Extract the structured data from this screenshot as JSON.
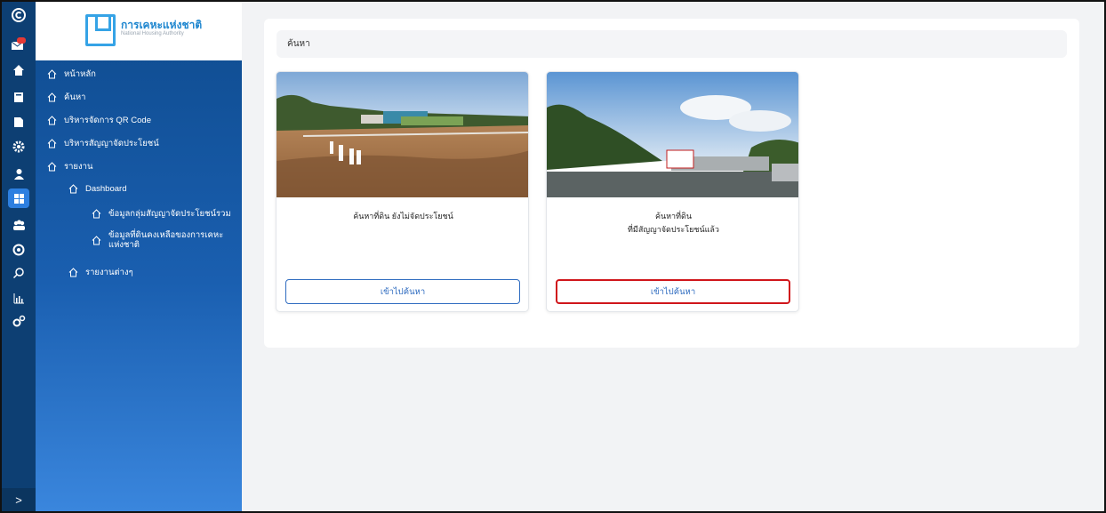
{
  "app": {
    "logo_th": "การเคหะแห่งชาติ",
    "logo_en": "National Housing Authority",
    "brand_color": "#0e4b8e",
    "accent_color": "#2f6cc0",
    "highlight_color": "#d0161b"
  },
  "rail": {
    "items": [
      {
        "icon": "copyright-logo-icon"
      },
      {
        "icon": "mail-notification-icon",
        "badge": "99+"
      },
      {
        "icon": "home-icon"
      },
      {
        "icon": "book-icon"
      },
      {
        "icon": "document-icon"
      },
      {
        "icon": "gear-icon"
      },
      {
        "icon": "user-icon"
      },
      {
        "icon": "dashboard-icon"
      },
      {
        "icon": "users-group-icon"
      },
      {
        "icon": "settings-cog-icon"
      },
      {
        "icon": "search-icon"
      },
      {
        "icon": "bar-chart-icon"
      },
      {
        "icon": "cogs-icon"
      }
    ],
    "expand_label": ">"
  },
  "sidebar": {
    "items": [
      {
        "label": "หน้าหลัก",
        "icon": "home-outline-icon"
      },
      {
        "label": "ค้นหา",
        "icon": "home-outline-icon"
      },
      {
        "label": "บริหารจัดการ QR Code",
        "icon": "home-outline-icon"
      },
      {
        "label": "บริหารสัญญาจัดประโยชน์",
        "icon": "home-outline-icon"
      },
      {
        "label": "รายงาน",
        "icon": "home-outline-icon"
      },
      {
        "label": "Dashboard",
        "icon": "home-outline-icon"
      },
      {
        "label": "ข้อมูลกลุ่มสัญญาจัดประโยชน์รวม",
        "icon": "home-outline-icon"
      },
      {
        "label": "ข้อมูลที่ดินคงเหลือของการเคหะแห่งชาติ",
        "icon": "home-outline-icon"
      },
      {
        "label": "รายงานต่างๆ",
        "icon": "home-outline-icon"
      }
    ]
  },
  "main": {
    "search_label": "ค้นหา",
    "cards": [
      {
        "title_line1": "ค้นหาที่ดิน ยังไม่จัดประโยชน์",
        "title_line2": "",
        "button_label": "เข้าไปค้นหา",
        "image_alt": "empty-land-photo"
      },
      {
        "title_line1": "ค้นหาที่ดิน",
        "title_line2": "ที่มีสัญญาจัดประโยชน์แล้ว",
        "button_label": "เข้าไปค้นหา",
        "image_alt": "leased-land-photo"
      }
    ]
  }
}
